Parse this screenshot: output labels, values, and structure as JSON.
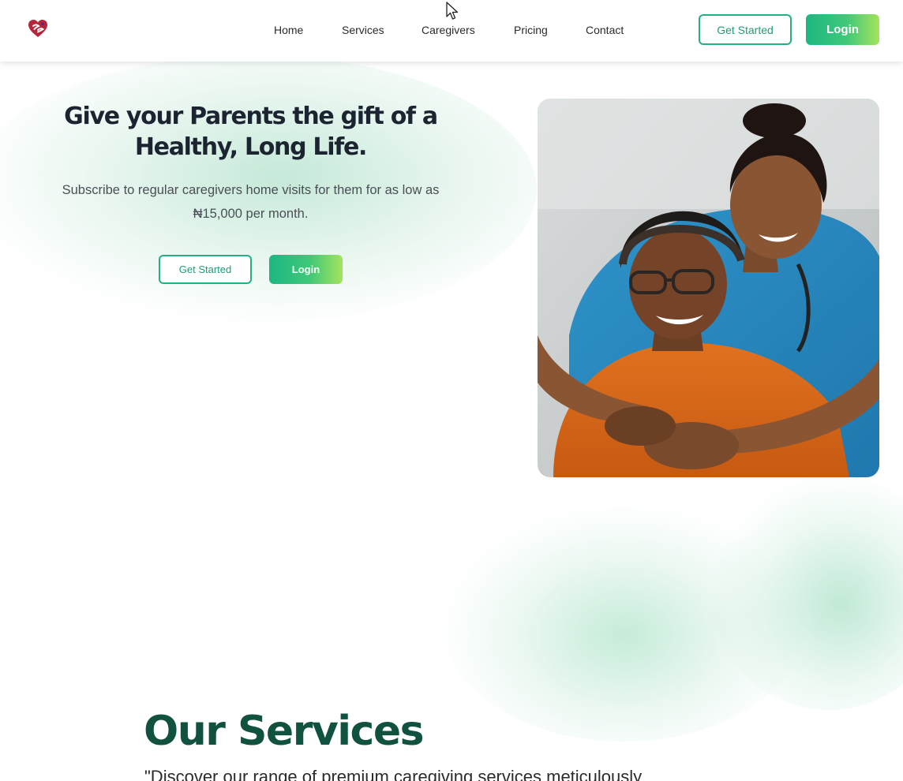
{
  "header": {
    "logo_icon": "heart-hands-logo",
    "nav": [
      "Home",
      "Services",
      "Caregivers",
      "Pricing",
      "Contact"
    ],
    "get_started_label": "Get Started",
    "login_label": "Login"
  },
  "hero": {
    "title_line1": "Give your Parents the gift of a",
    "title_line2": "Healthy, Long Life.",
    "subtitle_line1": "Subscribe to regular caregivers home visits for them for as low as",
    "subtitle_line2": "₦15,000 per month.",
    "get_started_label": "Get Started",
    "login_label": "Login",
    "photo_alt": "Smiling caregiver in blue scrubs hugging an elderly woman in an orange top"
  },
  "services": {
    "title": "Our Services",
    "description": "\"Discover our range of premium caregiving services meticulously"
  },
  "colors": {
    "accent_green": "#23b085",
    "dark_green": "#10523f",
    "gradient_end": "#a3e35b",
    "heading_dark": "#1b2430"
  }
}
